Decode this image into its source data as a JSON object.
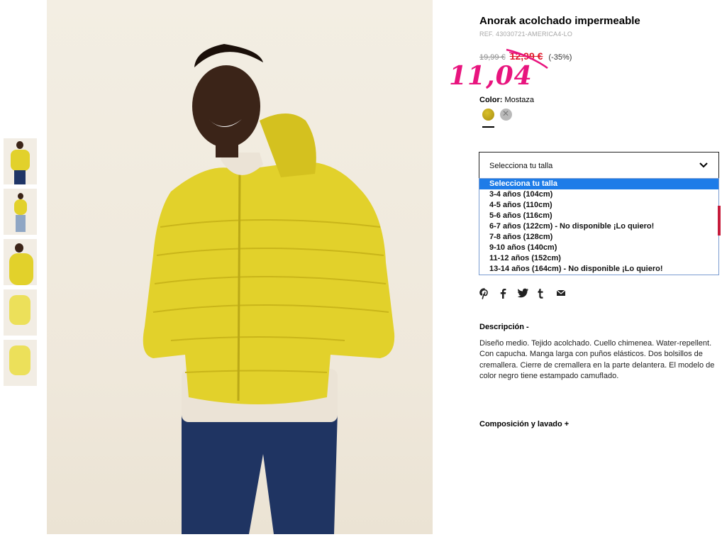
{
  "product": {
    "title": "Anorak acolchado impermeable",
    "ref": "REF. 43030721-AMERICA4-LO",
    "price_old": "19,99 €",
    "price_sale": "12,99 €",
    "discount": "(-35%)",
    "handwritten_price": "11,04"
  },
  "color": {
    "label": "Color:",
    "value": "Mostaza",
    "swatches": [
      "mostaza",
      "grey"
    ]
  },
  "size_select": {
    "label": "Selecciona tu talla",
    "options": [
      "Selecciona tu talla",
      "3-4 años (104cm)",
      "4-5 años (110cm)",
      "5-6 años (116cm)",
      "6-7 años (122cm) - No disponible ¡Lo quiero!",
      "7-8 años (128cm)",
      "9-10 años (140cm)",
      "11-12 años (152cm)",
      "13-14 años (164cm) - No disponible ¡Lo quiero!"
    ],
    "selected_index": 0
  },
  "social": [
    "pinterest-icon",
    "facebook-icon",
    "twitter-icon",
    "tumblr-icon",
    "email-icon"
  ],
  "description": {
    "title": "Descripción -",
    "text": "Diseño medio. Tejido acolchado. Cuello chimenea. Water-repellent. Con capucha. Manga larga con puños elásticos. Dos bolsillos de cremallera. Cierre de cremallera en la parte delantera. El modelo de color negro tiene estampado camuflado."
  },
  "composition": {
    "title": "Composición y lavado +"
  },
  "colors": {
    "sale_red": "#e0192c",
    "handwritten_pink": "#e8147e",
    "select_highlight": "#1e7ce8",
    "jacket_yellow": "#e2d12b"
  }
}
